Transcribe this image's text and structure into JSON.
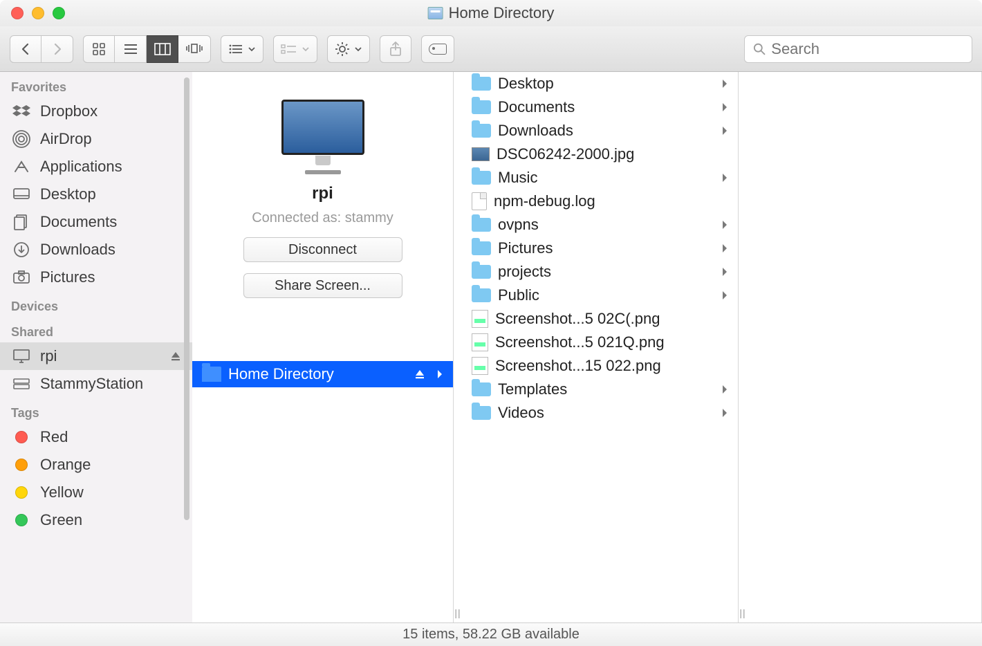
{
  "window": {
    "title": "Home Directory"
  },
  "toolbar": {
    "search_placeholder": "Search"
  },
  "sidebar": {
    "sections": {
      "favorites_label": "Favorites",
      "devices_label": "Devices",
      "shared_label": "Shared",
      "tags_label": "Tags"
    },
    "favorites": [
      {
        "label": "Dropbox",
        "icon": "dropbox"
      },
      {
        "label": "AirDrop",
        "icon": "airdrop"
      },
      {
        "label": "Applications",
        "icon": "applications"
      },
      {
        "label": "Desktop",
        "icon": "desktop"
      },
      {
        "label": "Documents",
        "icon": "documents"
      },
      {
        "label": "Downloads",
        "icon": "downloads"
      },
      {
        "label": "Pictures",
        "icon": "pictures"
      }
    ],
    "shared": [
      {
        "label": "rpi",
        "icon": "display",
        "selected": true,
        "ejectable": true
      },
      {
        "label": "StammyStation",
        "icon": "server",
        "selected": false,
        "ejectable": false
      }
    ],
    "tags": [
      {
        "label": "Red",
        "color": "#ff5b51"
      },
      {
        "label": "Orange",
        "color": "#ff9f0a"
      },
      {
        "label": "Yellow",
        "color": "#ffd60a"
      },
      {
        "label": "Green",
        "color": "#34c759"
      }
    ]
  },
  "server_panel": {
    "name": "rpi",
    "connected_as": "Connected as: stammy",
    "disconnect_label": "Disconnect",
    "share_screen_label": "Share Screen...",
    "selected_share": "Home Directory"
  },
  "files": [
    {
      "name": "Desktop",
      "type": "folder",
      "has_children": true
    },
    {
      "name": "Documents",
      "type": "folder",
      "has_children": true
    },
    {
      "name": "Downloads",
      "type": "folder",
      "has_children": true
    },
    {
      "name": "DSC06242-2000.jpg",
      "type": "image",
      "has_children": false
    },
    {
      "name": "Music",
      "type": "folder",
      "has_children": true
    },
    {
      "name": "npm-debug.log",
      "type": "file",
      "has_children": false
    },
    {
      "name": "ovpns",
      "type": "folder",
      "has_children": true
    },
    {
      "name": "Pictures",
      "type": "folder",
      "has_children": true
    },
    {
      "name": "projects",
      "type": "folder",
      "has_children": true
    },
    {
      "name": "Public",
      "type": "folder",
      "has_children": true
    },
    {
      "name": "Screenshot...5 02C(.png",
      "type": "png",
      "has_children": false
    },
    {
      "name": "Screenshot...5 021Q.png",
      "type": "png",
      "has_children": false
    },
    {
      "name": "Screenshot...15 022.png",
      "type": "png",
      "has_children": false
    },
    {
      "name": "Templates",
      "type": "folder",
      "has_children": true
    },
    {
      "name": "Videos",
      "type": "folder",
      "has_children": true
    }
  ],
  "status_bar": {
    "text": "15 items, 58.22 GB available"
  }
}
